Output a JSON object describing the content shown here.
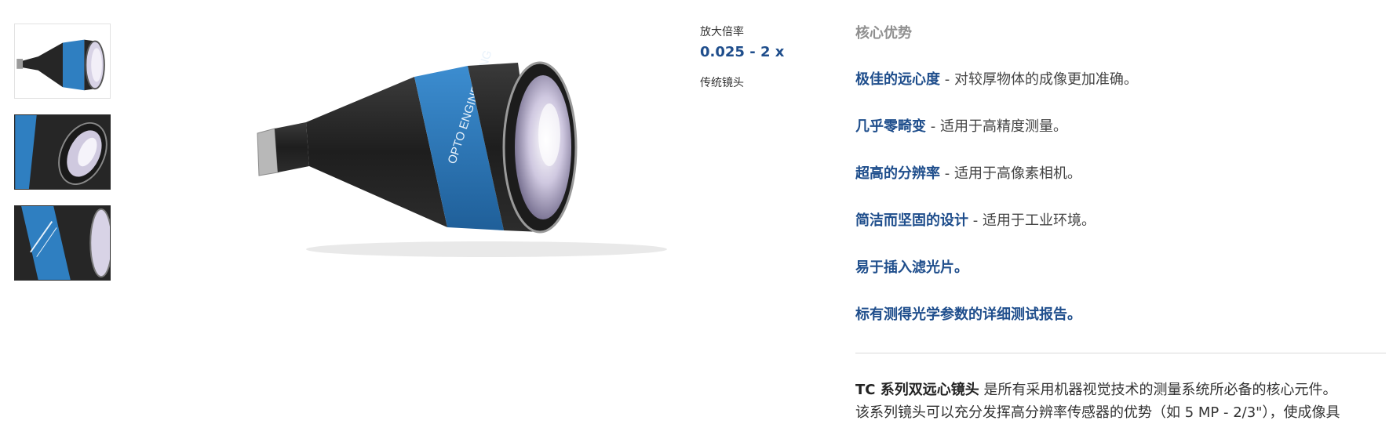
{
  "thumbnails": [
    {
      "icon": "lens-full-view-thumbnail"
    },
    {
      "icon": "lens-front-detail-thumbnail"
    },
    {
      "icon": "lens-label-detail-thumbnail"
    }
  ],
  "main_image": {
    "icon": "telecentric-lens-image",
    "brand_text": "OPTO ENGINEERING"
  },
  "specs": {
    "magnification_label": "放大倍率",
    "magnification_value": "0.025 - 2 x",
    "type_label": "传统镜头"
  },
  "advantages": {
    "title": "核心优势",
    "items": [
      {
        "strong": "极佳的远心度",
        "rest": " - 对较厚物体的成像更加准确。"
      },
      {
        "strong": "几乎零畸变",
        "rest": " - 适用于高精度测量。"
      },
      {
        "strong": "超高的分辨率",
        "rest": " - 适用于高像素相机。"
      },
      {
        "strong": "简洁而坚固的设计",
        "rest": " - 适用于工业环境。"
      },
      {
        "strong": "易于插入滤光片。",
        "rest": ""
      },
      {
        "strong": "标有测得光学参数的详细测试报告。",
        "rest": ""
      }
    ]
  },
  "description": {
    "strong": "TC 系列双远心镜头",
    "line1_rest": " 是所有采用机器视觉技术的测量系统所必备的核心元件。",
    "line2": "该系列镜头可以充分发挥高分辨率传感器的优势（如 5 MP - 2/3\"），使成像具"
  },
  "colors": {
    "accent": "#1f4e8c",
    "lens_blue": "#2f7fc1",
    "muted": "#8f8f8f"
  }
}
